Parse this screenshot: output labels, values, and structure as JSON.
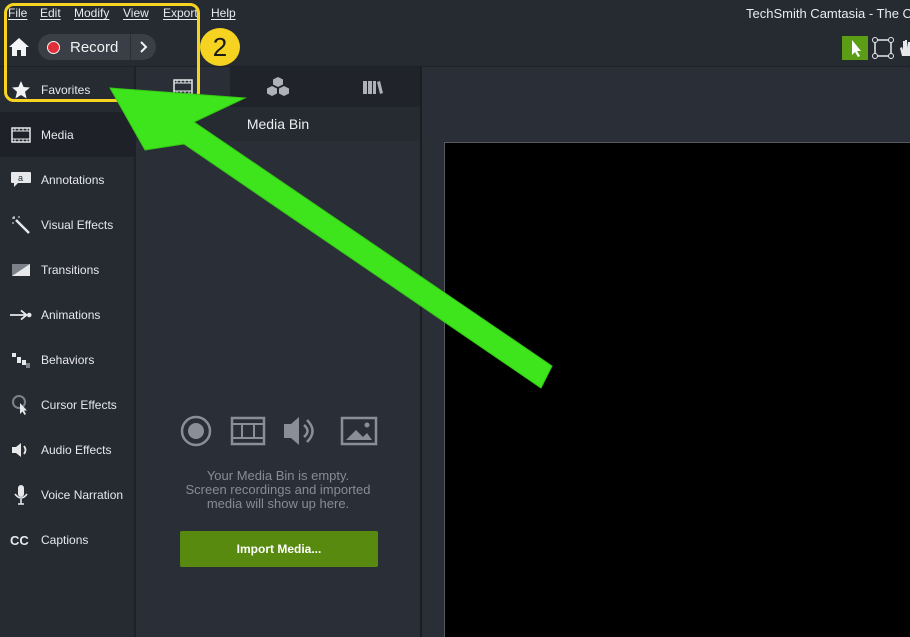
{
  "app": {
    "title": "TechSmith Camtasia - The C"
  },
  "menu": [
    "File",
    "Edit",
    "Modify",
    "View",
    "Export",
    "Help"
  ],
  "toolbar": {
    "record_label": "Record",
    "callout_number": "2"
  },
  "sidebar": {
    "items": [
      {
        "label": "Favorites",
        "icon": "star-icon"
      },
      {
        "label": "Media",
        "icon": "film-icon"
      },
      {
        "label": "Annotations",
        "icon": "annotation-icon"
      },
      {
        "label": "Visual Effects",
        "icon": "magic-wand-icon"
      },
      {
        "label": "Transitions",
        "icon": "transition-icon"
      },
      {
        "label": "Animations",
        "icon": "animation-icon"
      },
      {
        "label": "Behaviors",
        "icon": "behaviors-icon"
      },
      {
        "label": "Cursor Effects",
        "icon": "cursor-icon"
      },
      {
        "label": "Audio Effects",
        "icon": "speaker-icon"
      },
      {
        "label": "Voice Narration",
        "icon": "microphone-icon"
      },
      {
        "label": "Captions",
        "icon": "cc-icon"
      }
    ]
  },
  "media_bin": {
    "title": "Media Bin",
    "tabs": [
      "media-bin-tab",
      "library-cubes-tab",
      "library-books-tab"
    ],
    "empty_text": [
      "Your Media Bin is empty.",
      "Screen recordings and imported",
      "media will show up here."
    ],
    "import_label": "Import Media..."
  },
  "colors": {
    "accent_green": "#578a0e",
    "callout_yellow": "#f5d320",
    "arrow_green": "#3ee51c",
    "record_red": "#e12f39"
  }
}
